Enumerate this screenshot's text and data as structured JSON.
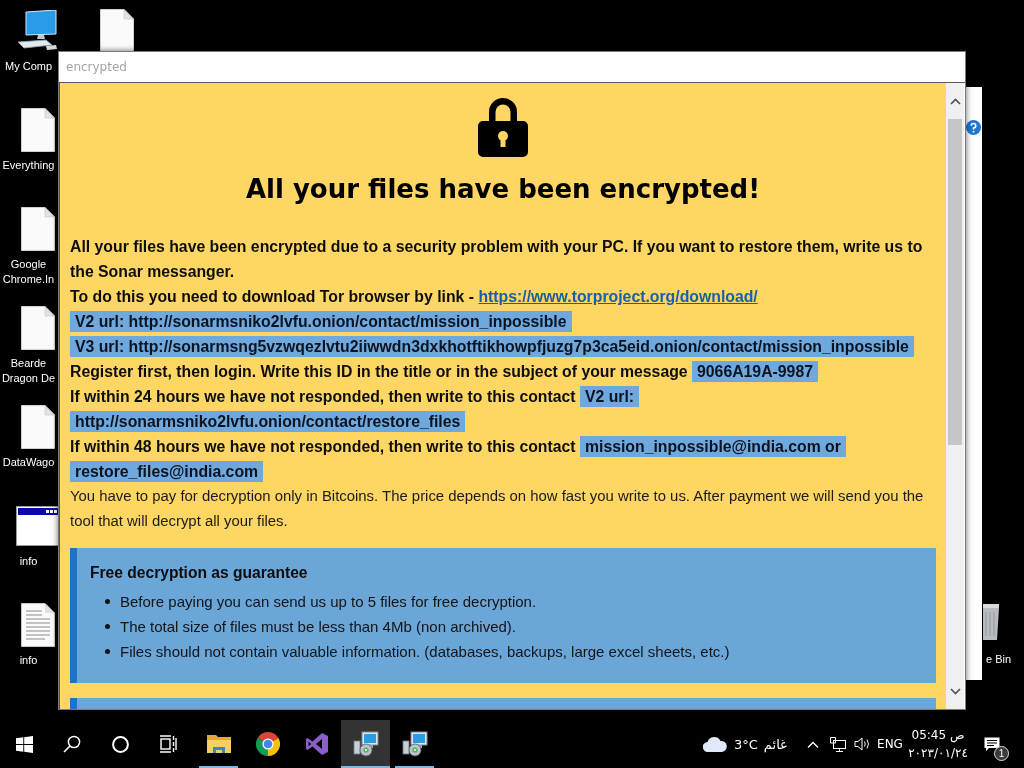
{
  "desktop_columns": [
    {
      "icons": [
        {
          "kind": "computer",
          "label": "My Comp"
        },
        {
          "kind": "file",
          "label": "Everything"
        },
        {
          "kind": "file",
          "label": "Google Chrome.In"
        },
        {
          "kind": "file",
          "label": "Bearde Dragon De"
        },
        {
          "kind": "file",
          "label": "DataWago"
        },
        {
          "kind": "window",
          "label": "info"
        },
        {
          "kind": "text",
          "label": "info"
        }
      ]
    },
    {
      "icons": [
        {
          "kind": "file"
        }
      ]
    }
  ],
  "recycle_bin": {
    "label": "e Bin"
  },
  "window": {
    "title": "encrypted"
  },
  "note": {
    "title": "All your files have been encrypted!",
    "paragraphs": [
      {
        "kind": "bold",
        "text": "All your files have been encrypted due to a security problem with your PC. If you want to restore them, write us to the Sonar messanger."
      },
      {
        "kind": "bold",
        "text": "To do this you need to download Tor browser by link -",
        "link": "https://www.torproject.org/download/"
      },
      {
        "kind": "bold",
        "highlights": [
          "V2 url: http://sonarmsniko2lvfu.onion/contact/mission_inpossible"
        ]
      },
      {
        "kind": "bold",
        "highlights": [
          "V3 url: http://sonarmsng5vzwqezlvtu2iiwwdn3dxkhotftikhowpfjuzg7p3ca5eid.onion/contact/mission_inpossible"
        ]
      },
      {
        "kind": "bold",
        "text": "Register first, then login. Write this ID in the title or in the subject of your message",
        "highlights": [
          "9066A19A-9987"
        ]
      },
      {
        "kind": "bold",
        "text": "If within 24 hours we have not responded, then write to this contact",
        "highlights": [
          "V2 url:",
          "http://sonarmsniko2lvfu.onion/contact/restore_files"
        ]
      },
      {
        "kind": "bold",
        "text": "If within 48 hours we have not responded, then write to this contact",
        "highlights": [
          "mission_inpossible@india.com or",
          "restore_files@india.com"
        ]
      },
      {
        "kind": "plain",
        "text": "You have to pay for decryption only in Bitcoins. The price depends on how fast you write to us. After payment we will send you the tool that will decrypt all your files."
      }
    ],
    "guarantee": {
      "title": "Free decryption as guarantee",
      "items": [
        "Before paying you can send us up to 5 files for free decryption.",
        "The total size of files must be less than 4Mb (non archived).",
        "Files should not contain valuable information. (databases, backups, large excel sheets, etc.)"
      ]
    }
  },
  "taskbar": {
    "apps": [
      {
        "kind": "folder",
        "open": true,
        "selected": false
      },
      {
        "kind": "browser",
        "open": false,
        "selected": false
      },
      {
        "kind": "ide",
        "open": false,
        "selected": false
      },
      {
        "kind": "installer",
        "open": true,
        "selected": true
      },
      {
        "kind": "installer",
        "open": true,
        "selected": false
      }
    ],
    "weather": {
      "temperature": "3°C",
      "condition": "غائم"
    },
    "language": "ENG",
    "clock": {
      "time": "05:45 ص",
      "date": "٢٠٢٣/٠١/٢٤"
    },
    "notifications": {
      "count": "1"
    }
  }
}
